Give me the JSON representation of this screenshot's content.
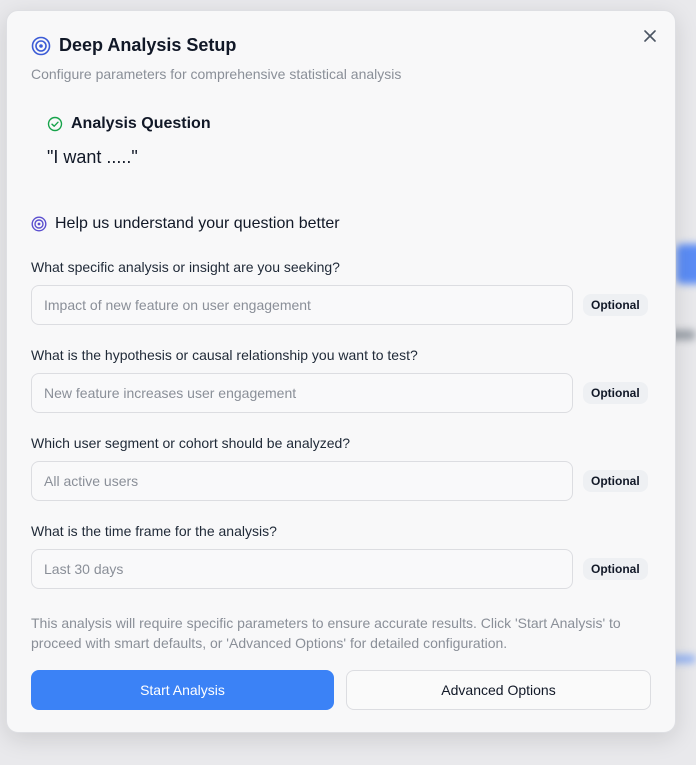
{
  "dialog": {
    "title": "Deep Analysis Setup",
    "subtitle": "Configure parameters for comprehensive statistical analysis",
    "close_icon": "close-icon",
    "title_icon": "target-icon"
  },
  "question": {
    "label": "Analysis Question",
    "text": "\"I want .....\"",
    "icon": "check-circle-icon"
  },
  "help": {
    "title": "Help us understand your question better",
    "icon": "target-icon"
  },
  "fields": [
    {
      "label": "What specific analysis or insight are you seeking?",
      "placeholder": "Impact of new feature on user engagement",
      "value": "",
      "badge": "Optional"
    },
    {
      "label": "What is the hypothesis or causal relationship you want to test?",
      "placeholder": "New feature increases user engagement",
      "value": "",
      "badge": "Optional"
    },
    {
      "label": "Which user segment or cohort should be analyzed?",
      "placeholder": "All active users",
      "value": "",
      "badge": "Optional"
    },
    {
      "label": "What is the time frame for the analysis?",
      "placeholder": "Last 30 days",
      "value": "",
      "badge": "Optional"
    }
  ],
  "note": "This analysis will require specific parameters to ensure accurate results. Click 'Start Analysis' to proceed with smart defaults, or 'Advanced Options' for detailed configuration.",
  "actions": {
    "primary_label": "Start Analysis",
    "secondary_label": "Advanced Options"
  },
  "colors": {
    "accent": "#3b82f6",
    "success": "#16a34a",
    "target": "#4f5bd5"
  }
}
